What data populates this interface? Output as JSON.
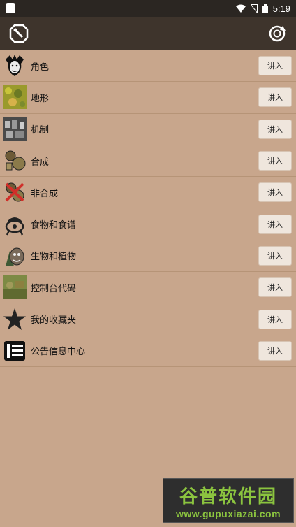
{
  "status_bar": {
    "time": "5:19"
  },
  "app": {
    "accent": "#3e342c",
    "background": "#c8a68c"
  },
  "menu": {
    "enter_label": "讲入",
    "items": [
      {
        "label": "角色",
        "icon": "character-icon"
      },
      {
        "label": "地形",
        "icon": "terrain-icon"
      },
      {
        "label": "机制",
        "icon": "mechanics-icon"
      },
      {
        "label": "合成",
        "icon": "craft-icon"
      },
      {
        "label": "非合成",
        "icon": "non-craft-icon"
      },
      {
        "label": "食物和食谱",
        "icon": "crockpot-icon"
      },
      {
        "label": "生物和植物",
        "icon": "creatures-icon"
      },
      {
        "label": "控制台代码",
        "icon": "console-icon"
      },
      {
        "label": "我的收藏夹",
        "icon": "star-icon"
      },
      {
        "label": "公告信息中心",
        "icon": "notice-icon"
      }
    ]
  },
  "watermark": {
    "title": "谷普软件园",
    "url": "www.gupuxiazai.com"
  }
}
